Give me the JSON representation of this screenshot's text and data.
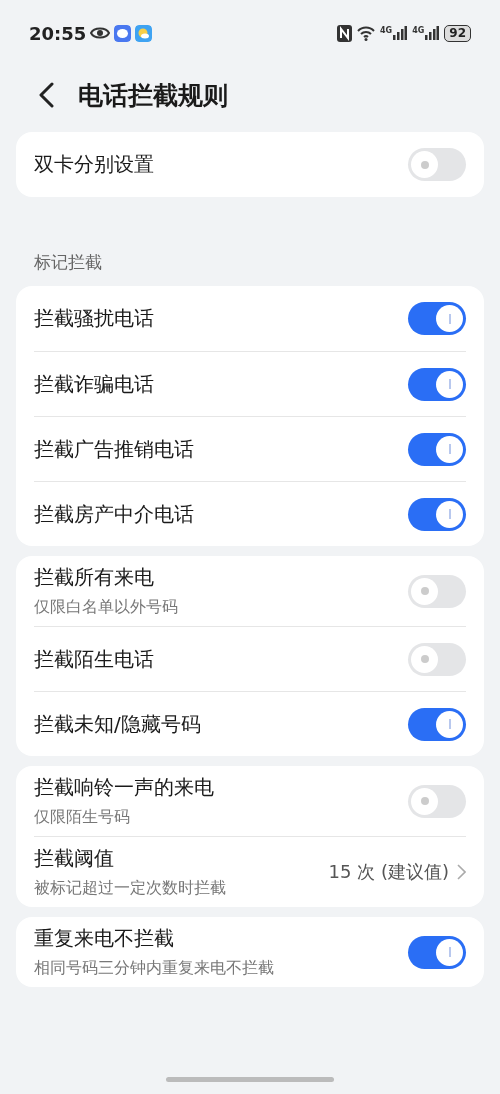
{
  "status_bar": {
    "time": "20:55",
    "network_labels": [
      "4G",
      "4G"
    ],
    "battery": "92"
  },
  "header": {
    "title": "电话拦截规则"
  },
  "groups": [
    {
      "rows": [
        {
          "kind": "toggle",
          "title": "双卡分别设置",
          "on": false
        }
      ]
    },
    {
      "label": "标记拦截",
      "rows": [
        {
          "kind": "toggle",
          "title": "拦截骚扰电话",
          "on": true
        },
        {
          "kind": "toggle",
          "title": "拦截诈骗电话",
          "on": true
        },
        {
          "kind": "toggle",
          "title": "拦截广告推销电话",
          "on": true
        },
        {
          "kind": "toggle",
          "title": "拦截房产中介电话",
          "on": true
        }
      ]
    },
    {
      "rows": [
        {
          "kind": "toggle",
          "title": "拦截所有来电",
          "subtitle": "仅限白名单以外号码",
          "on": false
        },
        {
          "kind": "toggle",
          "title": "拦截陌生电话",
          "on": false
        },
        {
          "kind": "toggle",
          "title": "拦截未知/隐藏号码",
          "on": true
        }
      ]
    },
    {
      "rows": [
        {
          "kind": "toggle",
          "title": "拦截响铃一声的来电",
          "subtitle": "仅限陌生号码",
          "on": false
        },
        {
          "kind": "value",
          "title": "拦截阈值",
          "subtitle": "被标记超过一定次数时拦截",
          "value": "15 次 (建议值)"
        }
      ]
    },
    {
      "rows": [
        {
          "kind": "toggle",
          "title": "重复来电不拦截",
          "subtitle": "相同号码三分钟内重复来电不拦截",
          "on": true
        }
      ]
    }
  ]
}
